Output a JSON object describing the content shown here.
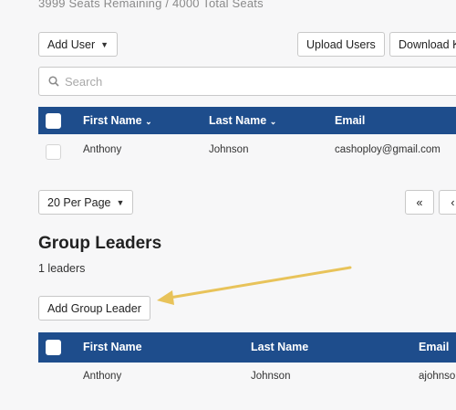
{
  "seats_summary": "3999 Seats Remaining / 4000 Total Seats",
  "toolbar": {
    "add_user": "Add User",
    "upload_users": "Upload Users",
    "download": "Download K"
  },
  "search": {
    "placeholder": "Search"
  },
  "users_table": {
    "columns": [
      "First Name",
      "Last Name",
      "Email"
    ],
    "rows": [
      {
        "first": "Anthony",
        "last": "Johnson",
        "email": "cashoploy@gmail.com"
      }
    ]
  },
  "pagination": {
    "per_page": "20 Per Page",
    "first": "«",
    "prev": "‹"
  },
  "group_leaders": {
    "title": "Group Leaders",
    "count": "1 leaders",
    "add_button": "Add Group Leader",
    "columns": [
      "First Name",
      "Last Name",
      "Email"
    ],
    "rows": [
      {
        "first": "Anthony",
        "last": "Johnson",
        "email": "ajohnso"
      }
    ]
  },
  "colors": {
    "header_blue": "#1e4d8c",
    "annotation_arrow": "#e8c35a"
  }
}
